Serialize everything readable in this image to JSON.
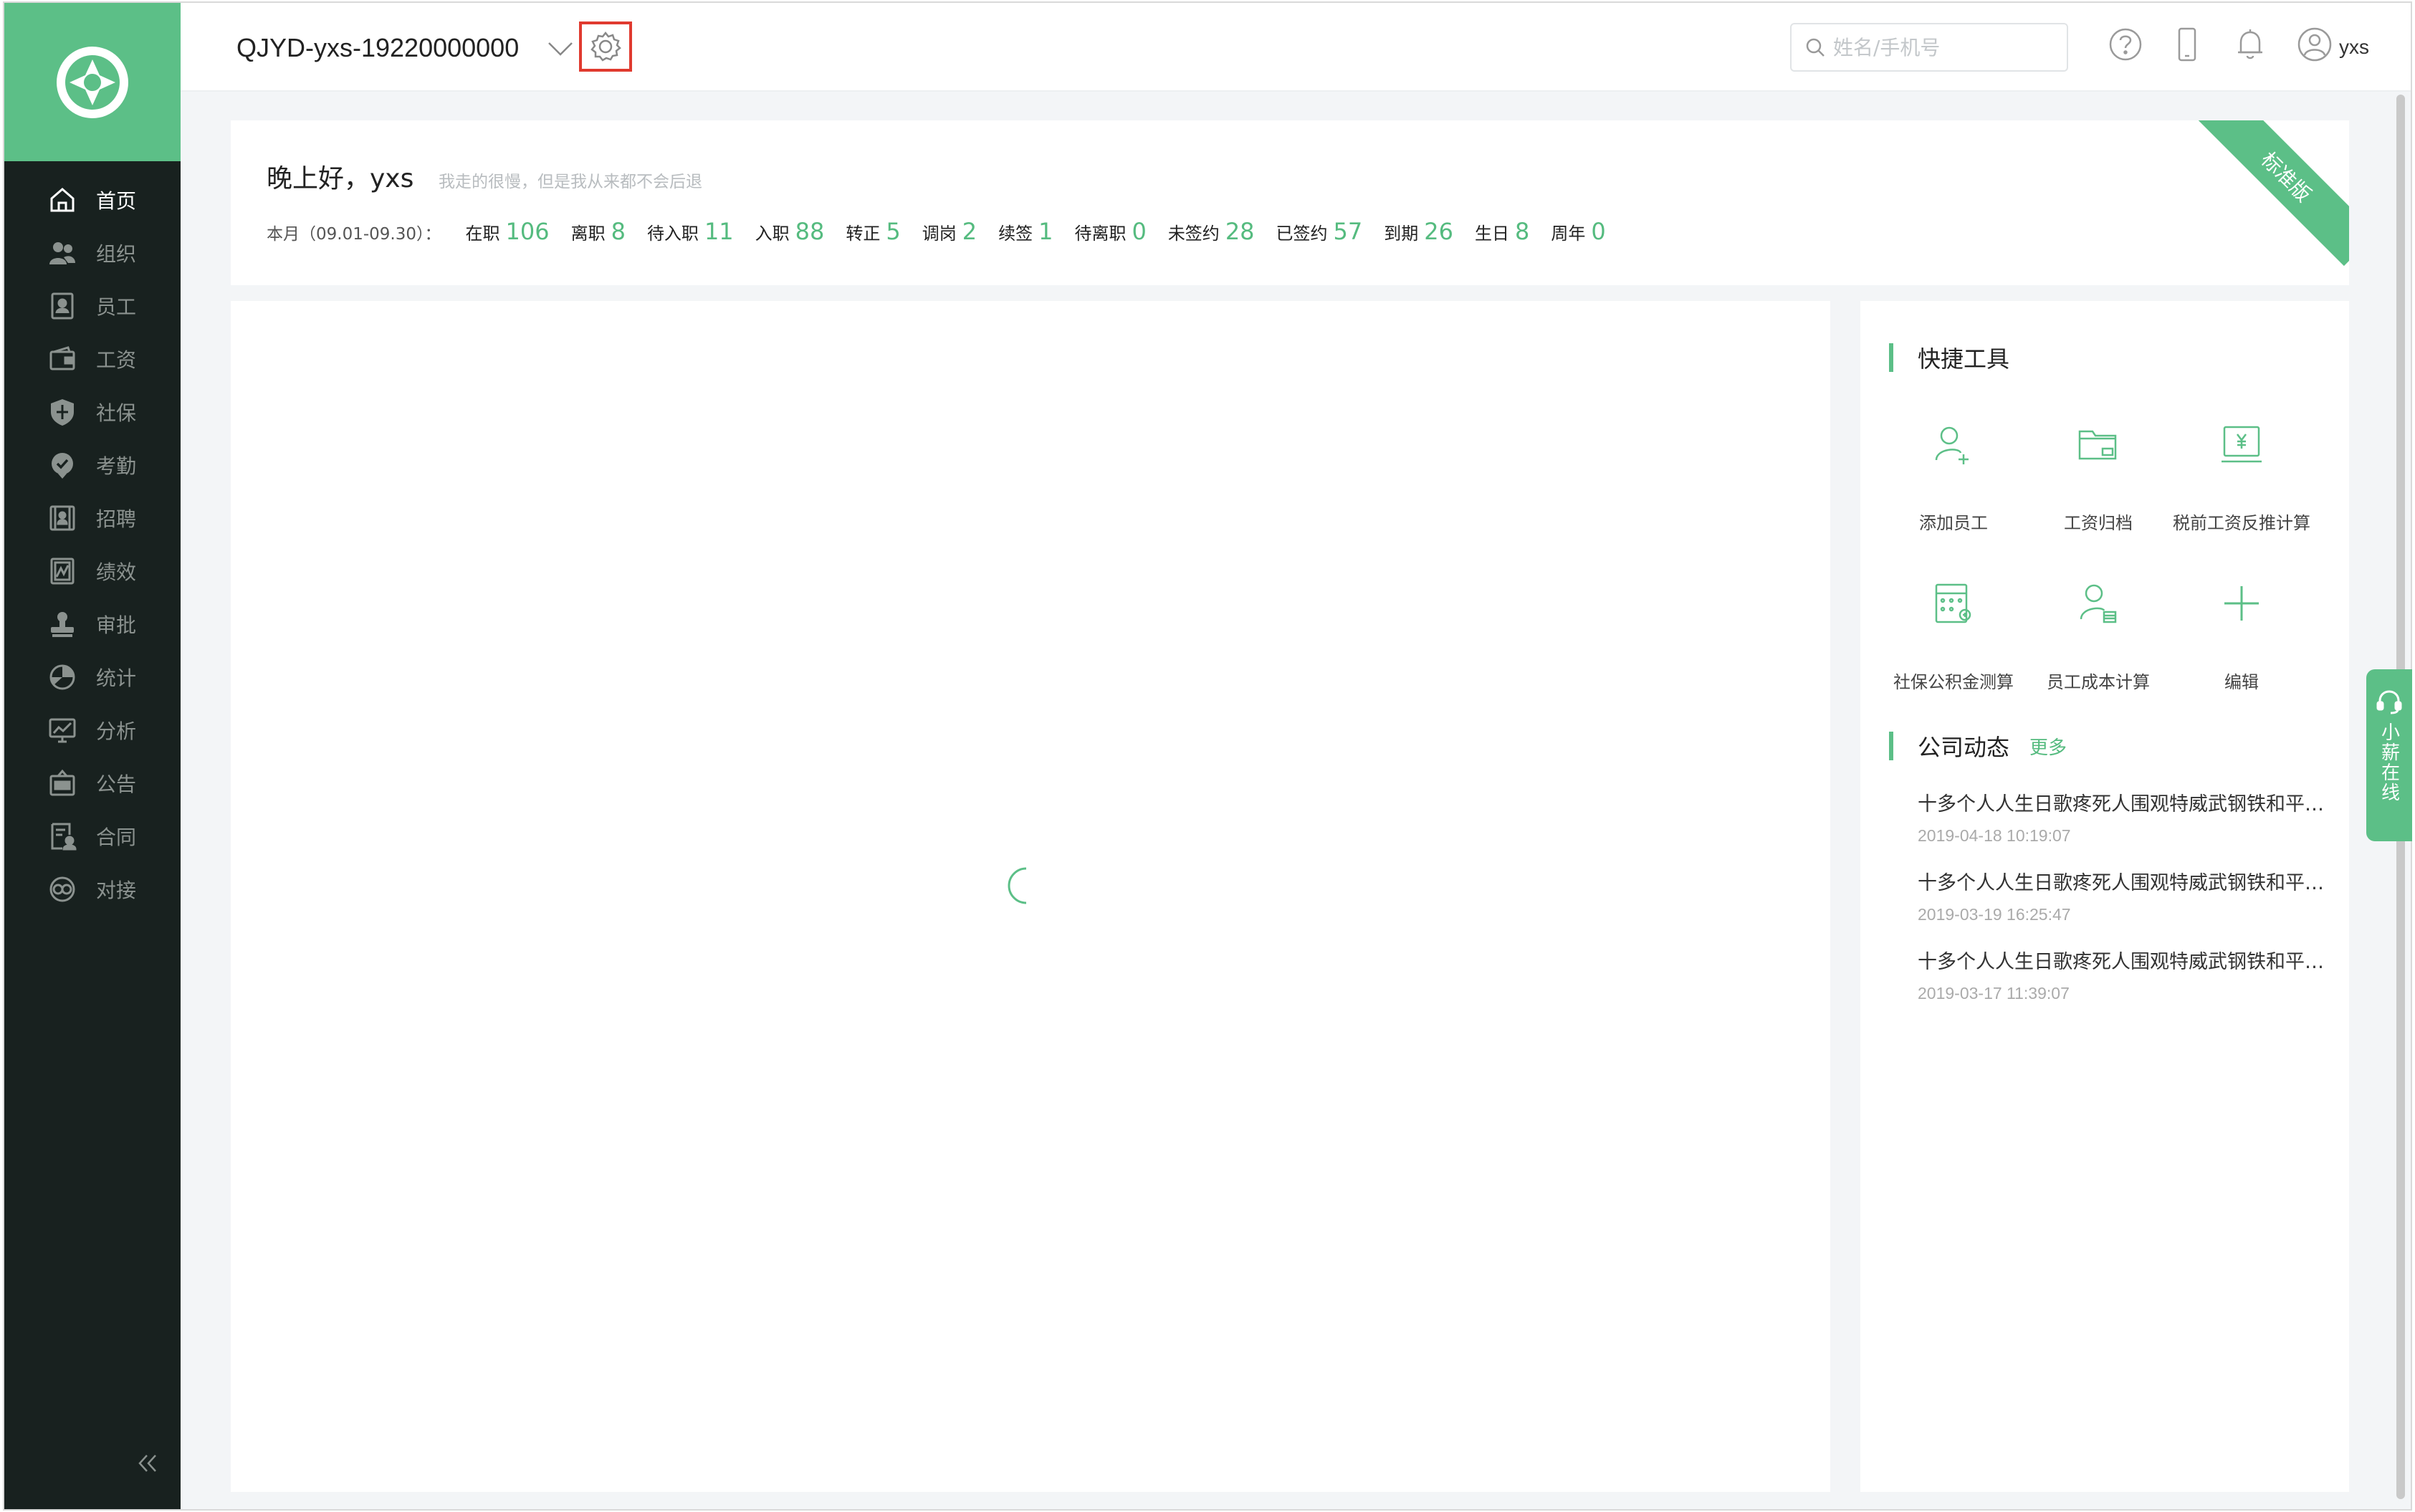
{
  "header": {
    "company": "QJYD-yxs-19220000000",
    "search_placeholder": "姓名/手机号",
    "username": "yxs"
  },
  "sidebar": {
    "items": [
      {
        "label": "首页",
        "icon": "home-icon",
        "active": true
      },
      {
        "label": "组织",
        "icon": "org-icon"
      },
      {
        "label": "员工",
        "icon": "employee-icon"
      },
      {
        "label": "工资",
        "icon": "wallet-icon"
      },
      {
        "label": "社保",
        "icon": "shield-icon"
      },
      {
        "label": "考勤",
        "icon": "location-check-icon"
      },
      {
        "label": "招聘",
        "icon": "recruit-icon"
      },
      {
        "label": "绩效",
        "icon": "performance-icon"
      },
      {
        "label": "审批",
        "icon": "stamp-icon"
      },
      {
        "label": "统计",
        "icon": "pie-icon"
      },
      {
        "label": "分析",
        "icon": "monitor-chart-icon"
      },
      {
        "label": "公告",
        "icon": "notice-icon"
      },
      {
        "label": "合同",
        "icon": "contract-icon"
      },
      {
        "label": "对接",
        "icon": "link-icon"
      }
    ]
  },
  "welcome": {
    "greeting": "晚上好，yxs",
    "motto": "我走的很慢，但是我从来都不会后退",
    "period": "本月（09.01-09.30）：",
    "stats": [
      {
        "label": "在职",
        "value": "106"
      },
      {
        "label": "离职",
        "value": "8"
      },
      {
        "label": "待入职",
        "value": "11"
      },
      {
        "label": "入职",
        "value": "88"
      },
      {
        "label": "转正",
        "value": "5"
      },
      {
        "label": "调岗",
        "value": "2"
      },
      {
        "label": "续签",
        "value": "1"
      },
      {
        "label": "待离职",
        "value": "0"
      },
      {
        "label": "未签约",
        "value": "28"
      },
      {
        "label": "已签约",
        "value": "57"
      },
      {
        "label": "到期",
        "value": "26"
      },
      {
        "label": "生日",
        "value": "8"
      },
      {
        "label": "周年",
        "value": "0"
      }
    ],
    "ribbon": "标准版"
  },
  "quick_tools": {
    "title": "快捷工具",
    "items": [
      {
        "label": "添加员工",
        "icon": "add-user-icon"
      },
      {
        "label": "工资归档",
        "icon": "folder-icon"
      },
      {
        "label": "税前工资反推计算",
        "icon": "tax-calc-icon"
      },
      {
        "label": "社保公积金测算",
        "icon": "calculator-icon"
      },
      {
        "label": "员工成本计算",
        "icon": "cost-user-icon"
      },
      {
        "label": "编辑",
        "icon": "plus-icon"
      }
    ]
  },
  "company_news": {
    "title": "公司动态",
    "more": "更多",
    "items": [
      {
        "title": "十多个人人生日歌疼死人围观特威武钢铁和平精英",
        "date": "2019-04-18 10:19:07"
      },
      {
        "title": "十多个人人生日歌疼死人围观特威武钢铁和平精英",
        "date": "2019-03-19 16:25:47"
      },
      {
        "title": "十多个人人生日歌疼死人围观特威武钢铁和平精英",
        "date": "2019-03-17 11:39:07"
      }
    ]
  },
  "help_tab": {
    "label": "小薪在线"
  },
  "colors": {
    "brand": "#5cbf87",
    "sidebar": "#18211f",
    "highlight": "#e03a2f"
  }
}
